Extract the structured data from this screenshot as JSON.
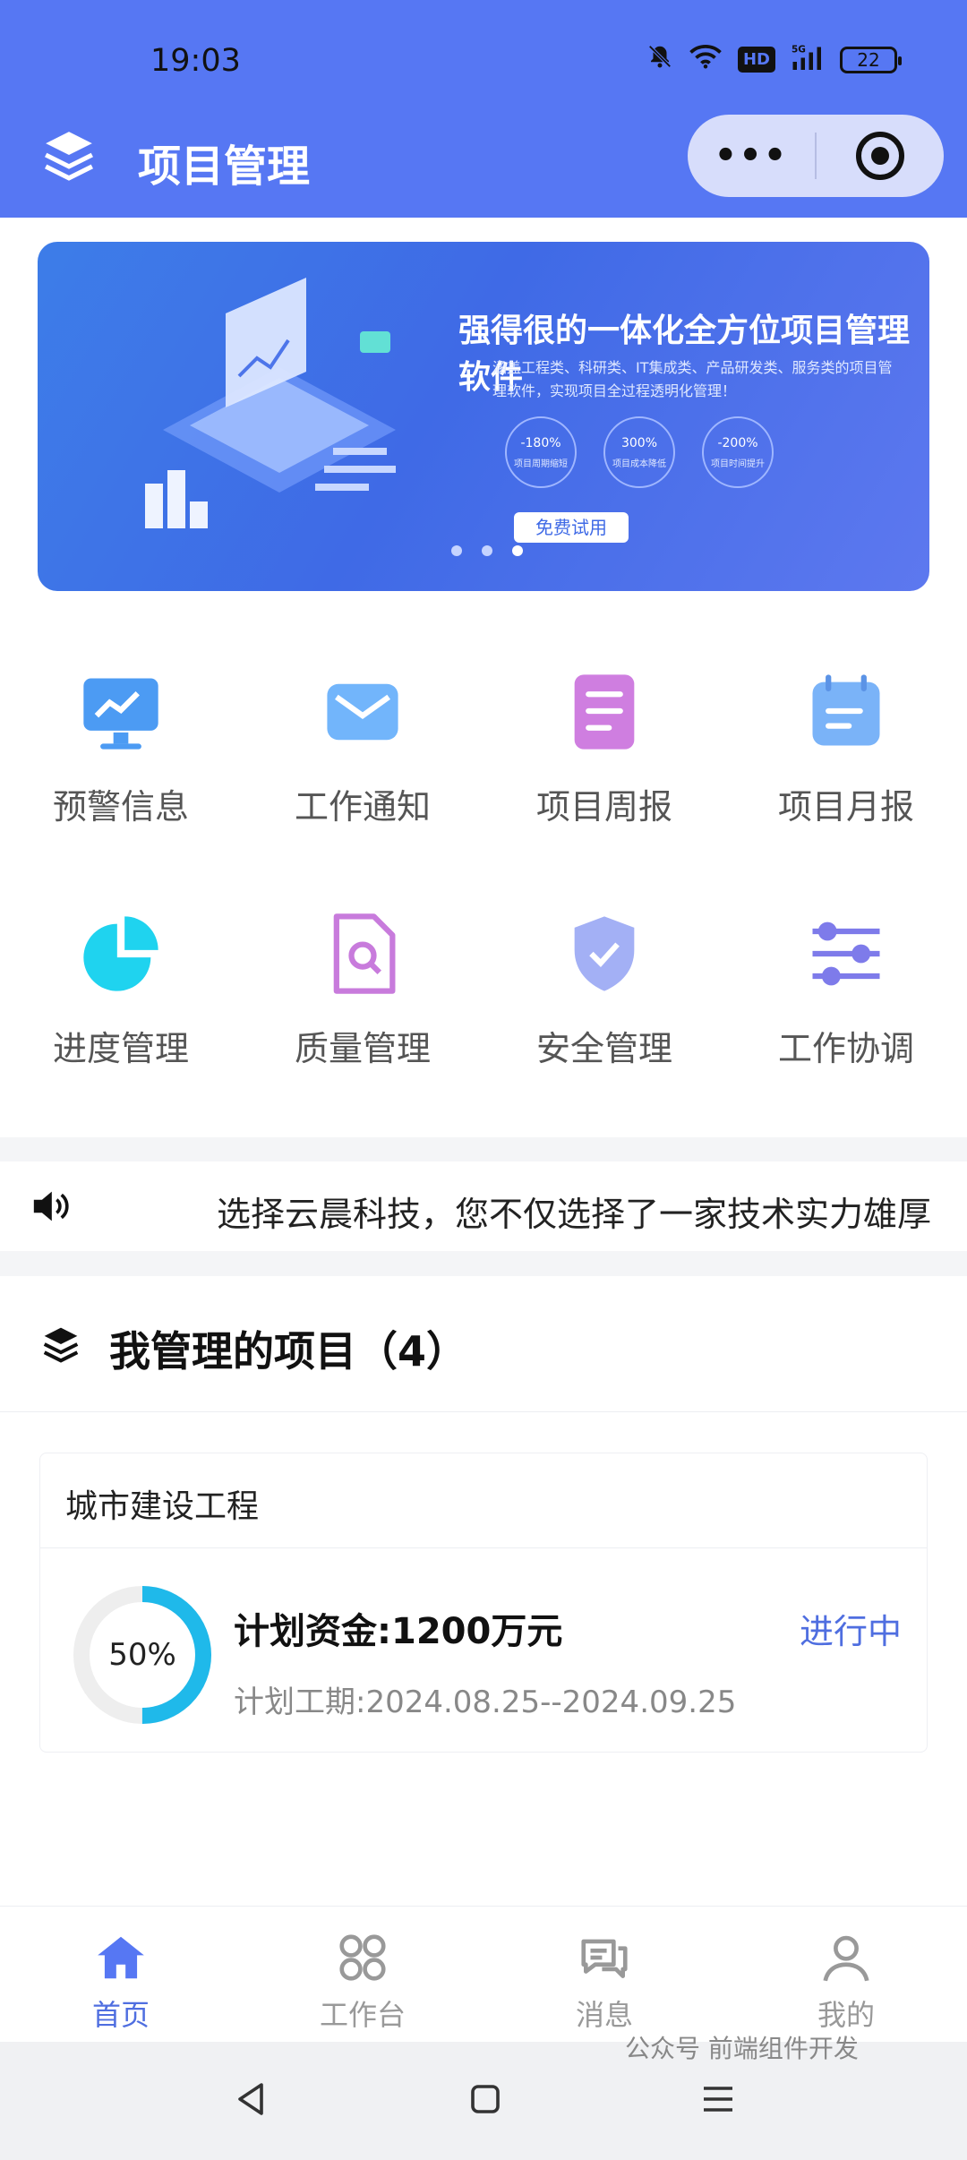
{
  "status_bar": {
    "time": "19:03",
    "battery": "22",
    "hd": "HD",
    "signal": "5G"
  },
  "header": {
    "title": "项目管理",
    "more_label": "•••"
  },
  "banner": {
    "title": "强得很的一体化全方位项目管理软件",
    "description": "涵盖工程类、科研类、IT集成类、产品研发类、服务类的项目管理软件，实现项目全过程透明化管理！",
    "stats": [
      {
        "value": "-180%",
        "label": "项目周期缩短"
      },
      {
        "value": "300%",
        "label": "项目成本降低"
      },
      {
        "value": "-200%",
        "label": "项目时间提升"
      }
    ],
    "button": "免费试用",
    "active_slide": 3,
    "slide_count": 3
  },
  "grid": [
    {
      "label": "预警信息",
      "icon": "monitor-chart-icon"
    },
    {
      "label": "工作通知",
      "icon": "mail-icon"
    },
    {
      "label": "项目周报",
      "icon": "document-list-icon"
    },
    {
      "label": "项目月报",
      "icon": "calendar-note-icon"
    },
    {
      "label": "进度管理",
      "icon": "pie-chart-icon"
    },
    {
      "label": "质量管理",
      "icon": "file-search-icon"
    },
    {
      "label": "安全管理",
      "icon": "shield-check-icon"
    },
    {
      "label": "工作协调",
      "icon": "sliders-icon"
    }
  ],
  "notice": {
    "text": "选择云晨科技，您不仅选择了一家技术实力雄厚"
  },
  "projects": {
    "heading": "我管理的项目（4）",
    "items": [
      {
        "name": "城市建设工程",
        "progress_label": "50%",
        "progress": 0.5,
        "fund": "计划资金:1200万元",
        "period": "计划工期:2024.08.25--2024.09.25",
        "status": "进行中"
      }
    ]
  },
  "tabs": [
    {
      "label": "首页",
      "icon": "home-icon",
      "active": true
    },
    {
      "label": "工作台",
      "icon": "grid-icon",
      "active": false
    },
    {
      "label": "消息",
      "icon": "chat-icon",
      "active": false
    },
    {
      "label": "我的",
      "icon": "user-icon",
      "active": false
    }
  ],
  "watermark": "公众号 前端组件开发",
  "colors": {
    "primary": "#5677f3",
    "accent": "#4f6ee0",
    "progress": "#1fb9ea"
  }
}
